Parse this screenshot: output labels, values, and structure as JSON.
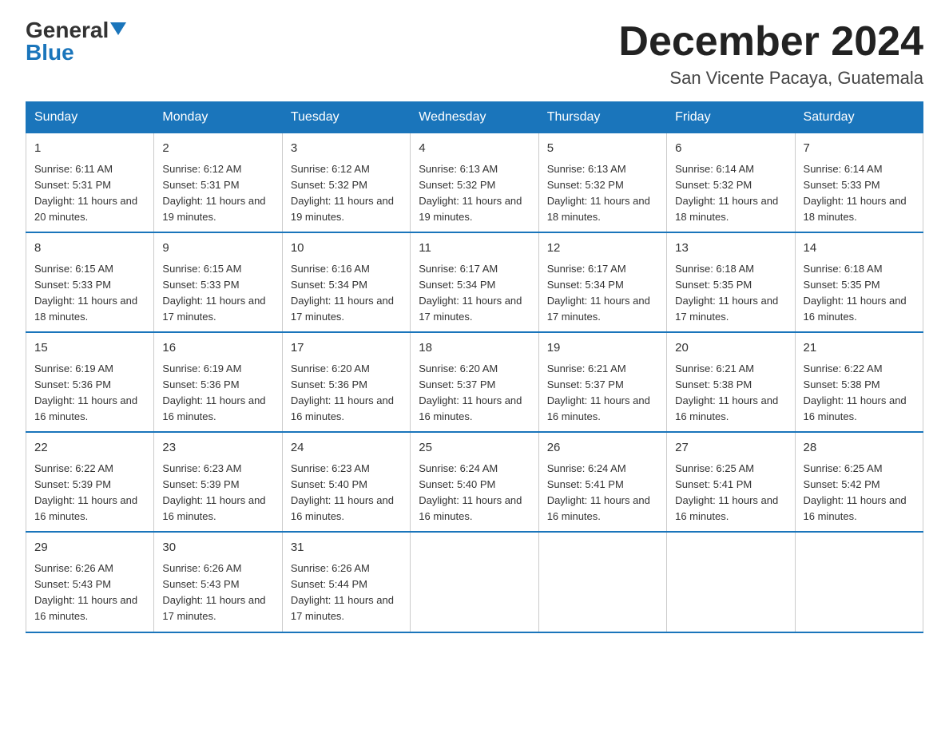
{
  "header": {
    "logo_general": "General",
    "logo_blue": "Blue",
    "month_title": "December 2024",
    "location": "San Vicente Pacaya, Guatemala"
  },
  "weekdays": [
    "Sunday",
    "Monday",
    "Tuesday",
    "Wednesday",
    "Thursday",
    "Friday",
    "Saturday"
  ],
  "weeks": [
    [
      {
        "day": "1",
        "sunrise": "6:11 AM",
        "sunset": "5:31 PM",
        "daylight": "11 hours and 20 minutes."
      },
      {
        "day": "2",
        "sunrise": "6:12 AM",
        "sunset": "5:31 PM",
        "daylight": "11 hours and 19 minutes."
      },
      {
        "day": "3",
        "sunrise": "6:12 AM",
        "sunset": "5:32 PM",
        "daylight": "11 hours and 19 minutes."
      },
      {
        "day": "4",
        "sunrise": "6:13 AM",
        "sunset": "5:32 PM",
        "daylight": "11 hours and 19 minutes."
      },
      {
        "day": "5",
        "sunrise": "6:13 AM",
        "sunset": "5:32 PM",
        "daylight": "11 hours and 18 minutes."
      },
      {
        "day": "6",
        "sunrise": "6:14 AM",
        "sunset": "5:32 PM",
        "daylight": "11 hours and 18 minutes."
      },
      {
        "day": "7",
        "sunrise": "6:14 AM",
        "sunset": "5:33 PM",
        "daylight": "11 hours and 18 minutes."
      }
    ],
    [
      {
        "day": "8",
        "sunrise": "6:15 AM",
        "sunset": "5:33 PM",
        "daylight": "11 hours and 18 minutes."
      },
      {
        "day": "9",
        "sunrise": "6:15 AM",
        "sunset": "5:33 PM",
        "daylight": "11 hours and 17 minutes."
      },
      {
        "day": "10",
        "sunrise": "6:16 AM",
        "sunset": "5:34 PM",
        "daylight": "11 hours and 17 minutes."
      },
      {
        "day": "11",
        "sunrise": "6:17 AM",
        "sunset": "5:34 PM",
        "daylight": "11 hours and 17 minutes."
      },
      {
        "day": "12",
        "sunrise": "6:17 AM",
        "sunset": "5:34 PM",
        "daylight": "11 hours and 17 minutes."
      },
      {
        "day": "13",
        "sunrise": "6:18 AM",
        "sunset": "5:35 PM",
        "daylight": "11 hours and 17 minutes."
      },
      {
        "day": "14",
        "sunrise": "6:18 AM",
        "sunset": "5:35 PM",
        "daylight": "11 hours and 16 minutes."
      }
    ],
    [
      {
        "day": "15",
        "sunrise": "6:19 AM",
        "sunset": "5:36 PM",
        "daylight": "11 hours and 16 minutes."
      },
      {
        "day": "16",
        "sunrise": "6:19 AM",
        "sunset": "5:36 PM",
        "daylight": "11 hours and 16 minutes."
      },
      {
        "day": "17",
        "sunrise": "6:20 AM",
        "sunset": "5:36 PM",
        "daylight": "11 hours and 16 minutes."
      },
      {
        "day": "18",
        "sunrise": "6:20 AM",
        "sunset": "5:37 PM",
        "daylight": "11 hours and 16 minutes."
      },
      {
        "day": "19",
        "sunrise": "6:21 AM",
        "sunset": "5:37 PM",
        "daylight": "11 hours and 16 minutes."
      },
      {
        "day": "20",
        "sunrise": "6:21 AM",
        "sunset": "5:38 PM",
        "daylight": "11 hours and 16 minutes."
      },
      {
        "day": "21",
        "sunrise": "6:22 AM",
        "sunset": "5:38 PM",
        "daylight": "11 hours and 16 minutes."
      }
    ],
    [
      {
        "day": "22",
        "sunrise": "6:22 AM",
        "sunset": "5:39 PM",
        "daylight": "11 hours and 16 minutes."
      },
      {
        "day": "23",
        "sunrise": "6:23 AM",
        "sunset": "5:39 PM",
        "daylight": "11 hours and 16 minutes."
      },
      {
        "day": "24",
        "sunrise": "6:23 AM",
        "sunset": "5:40 PM",
        "daylight": "11 hours and 16 minutes."
      },
      {
        "day": "25",
        "sunrise": "6:24 AM",
        "sunset": "5:40 PM",
        "daylight": "11 hours and 16 minutes."
      },
      {
        "day": "26",
        "sunrise": "6:24 AM",
        "sunset": "5:41 PM",
        "daylight": "11 hours and 16 minutes."
      },
      {
        "day": "27",
        "sunrise": "6:25 AM",
        "sunset": "5:41 PM",
        "daylight": "11 hours and 16 minutes."
      },
      {
        "day": "28",
        "sunrise": "6:25 AM",
        "sunset": "5:42 PM",
        "daylight": "11 hours and 16 minutes."
      }
    ],
    [
      {
        "day": "29",
        "sunrise": "6:26 AM",
        "sunset": "5:43 PM",
        "daylight": "11 hours and 16 minutes."
      },
      {
        "day": "30",
        "sunrise": "6:26 AM",
        "sunset": "5:43 PM",
        "daylight": "11 hours and 17 minutes."
      },
      {
        "day": "31",
        "sunrise": "6:26 AM",
        "sunset": "5:44 PM",
        "daylight": "11 hours and 17 minutes."
      },
      null,
      null,
      null,
      null
    ]
  ]
}
